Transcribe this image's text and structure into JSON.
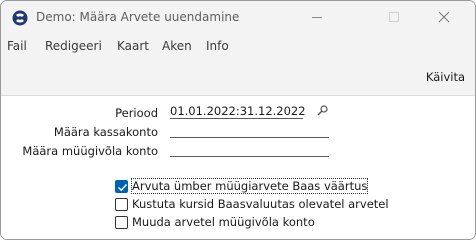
{
  "window": {
    "title": "Demo: Määra Arvete uuendamine",
    "icon": "hansaworld-app-icon",
    "controls": [
      "minimize-icon",
      "maximize-icon",
      "close-icon"
    ]
  },
  "menu": {
    "items": [
      "Fail",
      "Redigeeri",
      "Kaart",
      "Aken",
      "Info"
    ]
  },
  "toolbar": {
    "run_label": "Käivita"
  },
  "form": {
    "period": {
      "label": "Periood",
      "value": "01.01.2022:31.12.2022"
    },
    "cash_account": {
      "label": "Määra kassakonto",
      "value": ""
    },
    "sales_account": {
      "label": "Määra müügivõla konto",
      "value": ""
    }
  },
  "options": [
    {
      "label": "Arvuta ümber müügiarvete Baas väärtus",
      "checked": true
    },
    {
      "label": "Kustuta kursid Baasvaluutas olevatel arvetel",
      "checked": false
    },
    {
      "label": "Muuda arvetel müügivõla konto",
      "checked": false
    }
  ],
  "colors": {
    "accent": "#0063b1",
    "chrome": "#f3f3f3"
  }
}
